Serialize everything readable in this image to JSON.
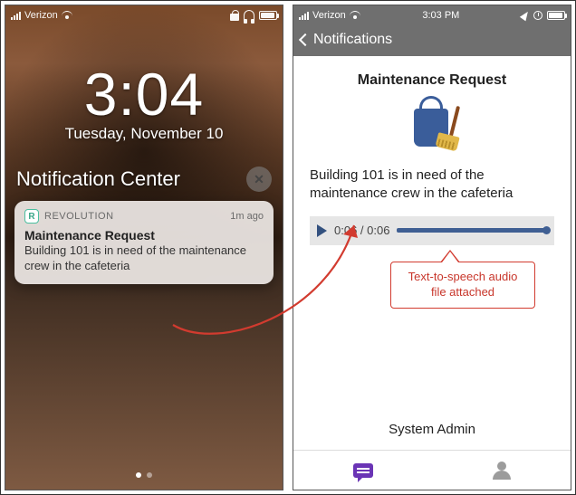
{
  "left": {
    "status": {
      "carrier": "Verizon"
    },
    "clock": {
      "time": "3:04",
      "date": "Tuesday, November 10"
    },
    "nc_title": "Notification Center",
    "notification": {
      "app_badge_letter": "R",
      "app_name": "REVOLUTION",
      "age": "1m ago",
      "title": "Maintenance Request",
      "body": "Building 101 is in need of the maintenance crew in the cafeteria"
    }
  },
  "right": {
    "status": {
      "carrier": "Verizon",
      "time": "3:03 PM"
    },
    "nav_title": "Notifications",
    "heading": "Maintenance Request",
    "message": "Building 101 is in need of the maintenance crew in the cafeteria",
    "audio": {
      "current": "0:06",
      "total": "0:06"
    },
    "footer_label": "System Admin"
  },
  "annotation": {
    "callout_text": "Text-to-speech audio file attached"
  }
}
